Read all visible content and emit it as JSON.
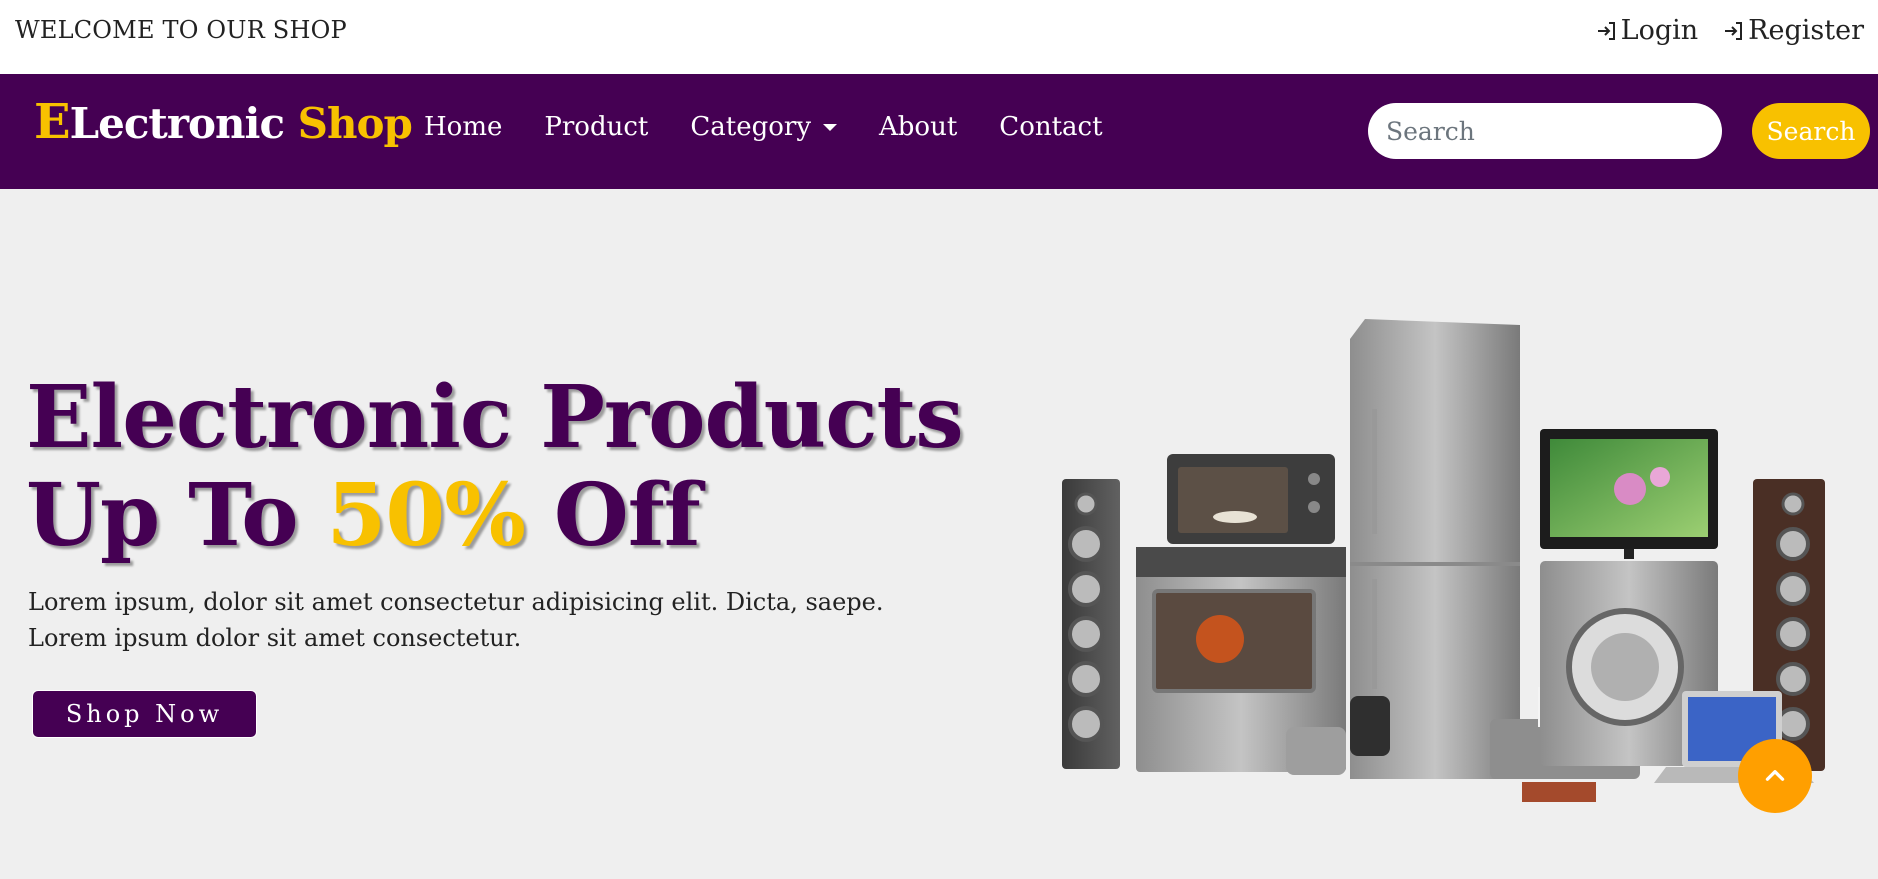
{
  "topbar": {
    "welcome": "WELCOME TO OUR SHOP",
    "login_label": "Login",
    "register_label": "Register"
  },
  "navbar": {
    "brand_first_letter": "E",
    "brand_rest": "Lectronic",
    "brand_shop": "Shop",
    "menu": {
      "home": "Home",
      "product": "Product",
      "category": "Category",
      "about": "About",
      "contact": "Contact"
    },
    "search_placeholder": "Search",
    "search_button": "Search"
  },
  "hero": {
    "title_line1": "Electronic Products",
    "title_line2_pre": "Up To",
    "title_line2_accent": "50%",
    "title_line2_post": "Off",
    "description": "Lorem ipsum, dolor sit amet consectetur adipisicing elit. Dicta, saepe. Lorem ipsum dolor sit amet consectetur.",
    "cta": "Shop Now"
  },
  "colors": {
    "brand_purple": "#450053",
    "accent_yellow": "#f8c100",
    "scroll_orange": "#ff9f00",
    "page_bg": "#efefef"
  },
  "icons": [
    "login-icon",
    "register-icon",
    "caret-down-icon",
    "chevron-up-icon"
  ]
}
